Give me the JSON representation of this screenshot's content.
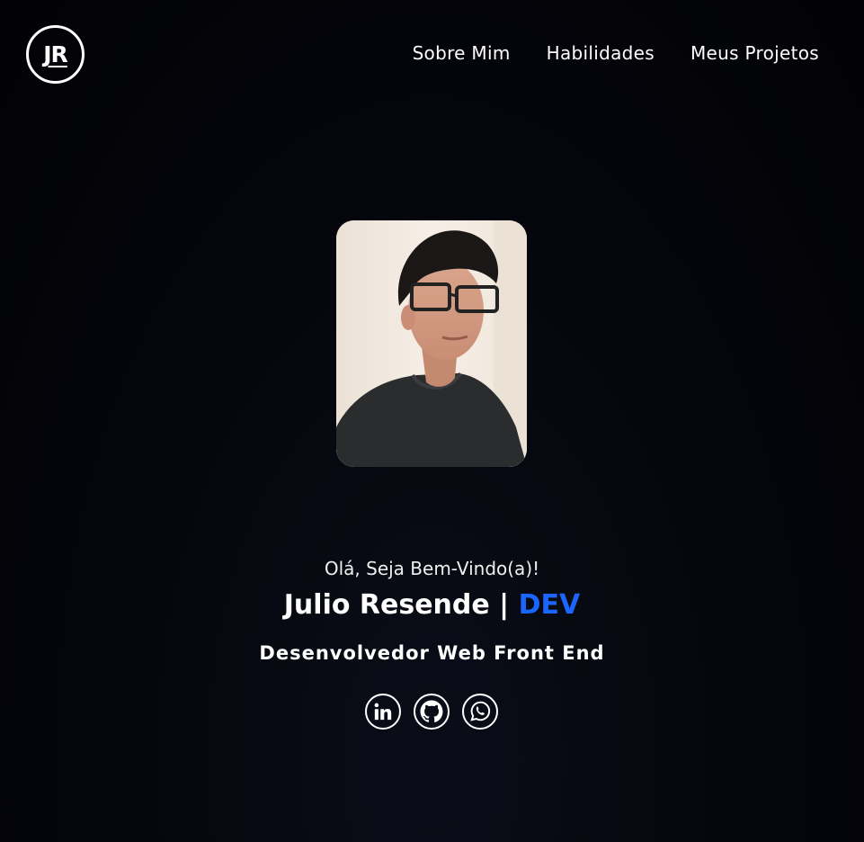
{
  "logo": {
    "text": "JR"
  },
  "nav": {
    "items": [
      {
        "label": "Sobre Mim"
      },
      {
        "label": "Habilidades"
      },
      {
        "label": "Meus Projetos"
      }
    ]
  },
  "hero": {
    "greeting": "Olá, Seja Bem-Vindo(a)!",
    "name": "Julio Resende |",
    "name_accent": "DEV",
    "role": "Desenvolvedor Web Front End"
  },
  "social": [
    {
      "icon": "linkedin-icon"
    },
    {
      "icon": "github-icon"
    },
    {
      "icon": "whatsapp-icon"
    }
  ],
  "colors": {
    "background": "#05060c",
    "text": "#ffffff",
    "accent": "#1a66ff"
  }
}
